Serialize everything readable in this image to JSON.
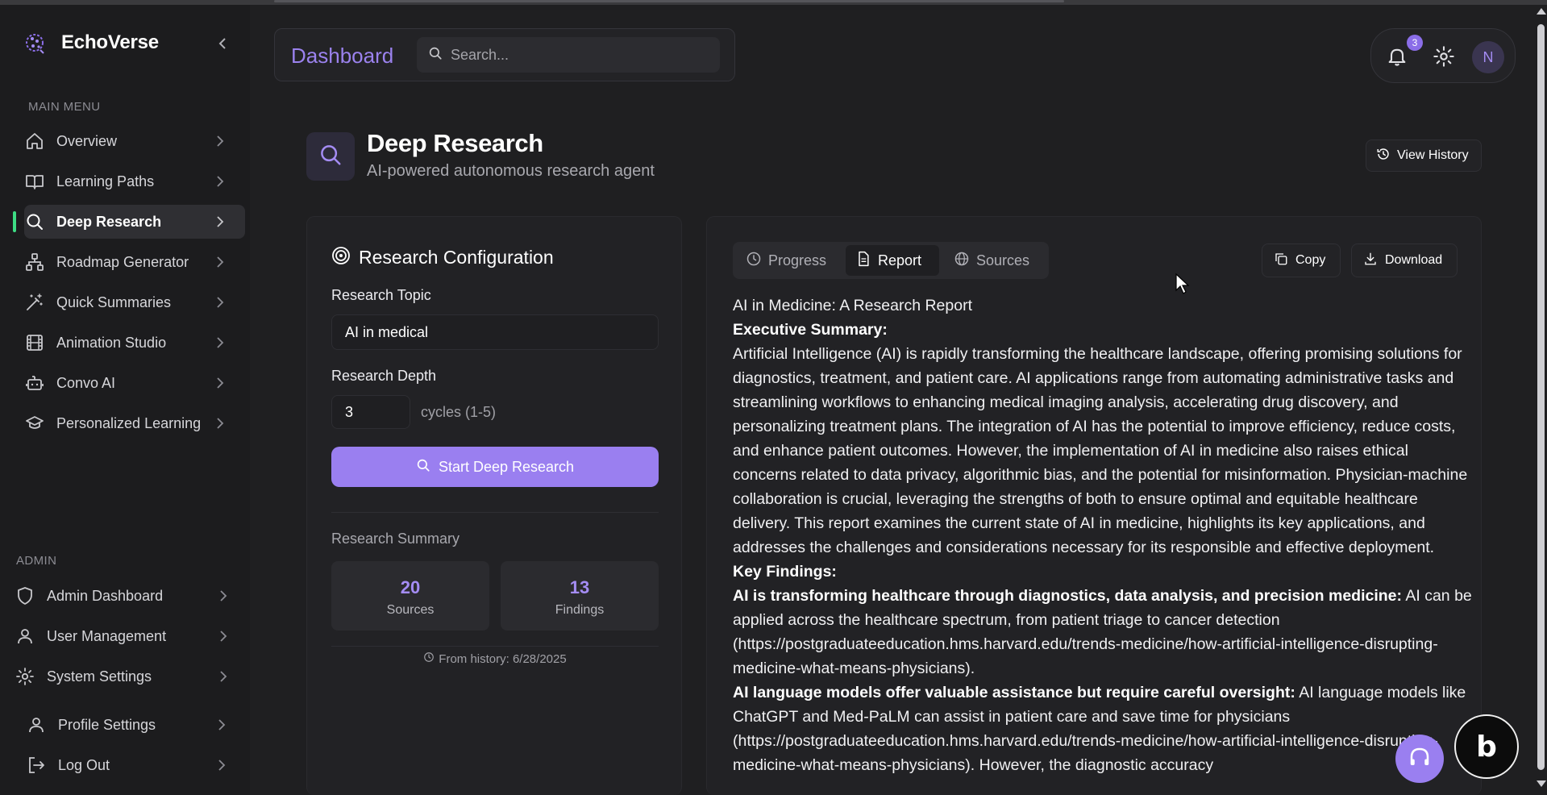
{
  "sidebar": {
    "brand": "EchoVerse",
    "main_menu_label": "MAIN MENU",
    "items": [
      {
        "label": "Overview"
      },
      {
        "label": "Learning Paths"
      },
      {
        "label": "Deep Research"
      },
      {
        "label": "Roadmap Generator"
      },
      {
        "label": "Quick Summaries"
      },
      {
        "label": "Animation Studio"
      },
      {
        "label": "Convo AI"
      },
      {
        "label": "Personalized Learning"
      }
    ],
    "admin_label": "ADMIN",
    "admin_items": [
      {
        "label": "Admin Dashboard"
      },
      {
        "label": "User Management"
      },
      {
        "label": "System Settings"
      }
    ],
    "bottom_items": [
      {
        "label": "Profile Settings"
      },
      {
        "label": "Log Out"
      }
    ]
  },
  "header": {
    "title": "Dashboard",
    "search_placeholder": "Search...",
    "notification_count": "3",
    "avatar_initial": "N"
  },
  "page": {
    "title": "Deep Research",
    "subtitle": "AI-powered autonomous research agent",
    "view_history": "View History"
  },
  "config": {
    "title": "Research Configuration",
    "topic_label": "Research Topic",
    "topic_value": "AI in medical",
    "depth_label": "Research Depth",
    "depth_value": "3",
    "cycles_hint": "cycles (1-5)",
    "start_button": "Start Deep Research",
    "summary_label": "Research Summary",
    "sources_count": "20",
    "sources_label": "Sources",
    "findings_count": "13",
    "findings_label": "Findings",
    "history_note": "From history: 6/28/2025"
  },
  "report": {
    "tabs": [
      {
        "label": "Progress"
      },
      {
        "label": "Report"
      },
      {
        "label": "Sources"
      }
    ],
    "copy_label": "Copy",
    "download_label": "Download",
    "heading": "AI in Medicine: A Research Report",
    "exec_summary_title": "Executive Summary:",
    "exec_summary": "Artificial Intelligence (AI) is rapidly transforming the healthcare landscape, offering promising solutions for diagnostics, treatment, and patient care. AI applications range from automating administrative tasks and streamlining workflows to enhancing medical imaging analysis, accelerating drug discovery, and personalizing treatment plans. The integration of AI has the potential to improve efficiency, reduce costs, and enhance patient outcomes. However, the implementation of AI in medicine also raises ethical concerns related to data privacy, algorithmic bias, and the potential for misinformation. Physician-machine collaboration is crucial, leveraging the strengths of both to ensure optimal and equitable healthcare delivery. This report examines the current state of AI in medicine, highlights its key applications, and addresses the challenges and considerations necessary for its responsible and effective deployment.",
    "key_findings_title": "Key Findings:",
    "finding1_title": "AI is transforming healthcare through diagnostics, data analysis, and precision medicine:",
    "finding1_text": " AI can be applied across the healthcare spectrum, from patient triage to cancer detection (https://postgraduateeducation.hms.harvard.edu/trends-medicine/how-artificial-intelligence-disrupting-medicine-what-means-physicians).",
    "finding2_title": "AI language models offer valuable assistance but require careful oversight:",
    "finding2_text": " AI language models like ChatGPT and Med-PaLM can assist in patient care and save time for physicians (https://postgraduateeducation.hms.harvard.edu/trends-medicine/how-artificial-intelligence-disrupting-medicine-what-means-physicians). However, the diagnostic accuracy"
  },
  "colors": {
    "accent": "#9a7ff0",
    "active_indicator": "#3ddc84",
    "background": "#1f1f21"
  }
}
